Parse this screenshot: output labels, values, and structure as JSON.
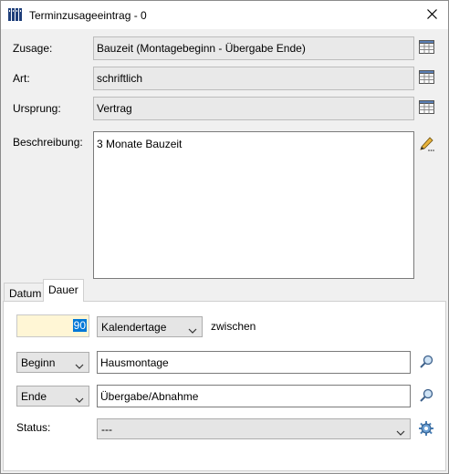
{
  "window": {
    "title": "Terminzusageeintrag - 0"
  },
  "fields": {
    "zusage": {
      "label": "Zusage:",
      "value": "Bauzeit (Montagebeginn - Übergabe Ende)"
    },
    "art": {
      "label": "Art:",
      "value": "schriftlich"
    },
    "ursprung": {
      "label": "Ursprung:",
      "value": "Vertrag"
    },
    "beschreibung": {
      "label": "Beschreibung:",
      "value": "3 Monate Bauzeit"
    }
  },
  "tabs": [
    {
      "label": "Datum",
      "active": false
    },
    {
      "label": "Dauer",
      "active": true
    }
  ],
  "dauer": {
    "amount": "90",
    "unit": "Kalendertage",
    "between_label": "zwischen",
    "start": {
      "mode": "Beginn",
      "value": "Hausmontage"
    },
    "end": {
      "mode": "Ende",
      "value": "Übergabe/Abnahme"
    },
    "status": {
      "label": "Status:",
      "value": "---"
    }
  },
  "colors": {
    "accent": "#0078d7",
    "highlight_input": "#fff6d5"
  },
  "icons": {
    "app": "building-icon",
    "close": "close-icon",
    "lookup": "table-icon",
    "edit": "pencil-icon",
    "search": "magnifier-icon",
    "settings": "gear-icon"
  }
}
